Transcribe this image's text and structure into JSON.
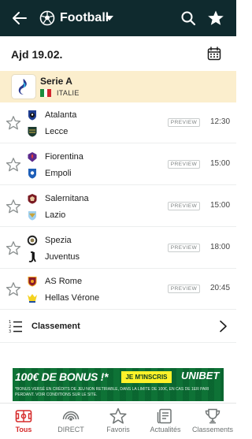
{
  "header": {
    "title": "Football",
    "icons": {
      "back": "back-arrow-icon",
      "sport": "football-icon",
      "dropdown": "caret-down-icon",
      "search": "search-icon",
      "favorite": "star-icon"
    },
    "bg_color": "#0f2a2e"
  },
  "date": {
    "label": "Ajd 19.02.",
    "icon": "calendar-icon"
  },
  "league": {
    "name": "Serie A",
    "country": "ITALIE",
    "logo_text": "SERIE A",
    "bg_color": "#fbeecd"
  },
  "matches": [
    {
      "home": "Atalanta",
      "away": "Lecce",
      "badge": "PREVIEW",
      "time": "12:30"
    },
    {
      "home": "Fiorentina",
      "away": "Empoli",
      "badge": "PREVIEW",
      "time": "15:00"
    },
    {
      "home": "Salernitana",
      "away": "Lazio",
      "badge": "PREVIEW",
      "time": "15:00"
    },
    {
      "home": "Spezia",
      "away": "Juventus",
      "badge": "PREVIEW",
      "time": "18:00"
    },
    {
      "home": "AS Rome",
      "away": "Hellas Vérone",
      "badge": "PREVIEW",
      "time": "20:45"
    }
  ],
  "standings": {
    "label": "Classement"
  },
  "ad": {
    "headline": "100€ DE BONUS !*",
    "cta": "JE M'INSCRIS",
    "brand": "UNIBET",
    "fine_print": "*BONUS VERSÉ EN CRÉDITS DE JEU NON RETIRABLE, DANS LA LIMITE DE 100€, EN CAS DE 1ER PARI PERDANT. VOIR CONDITIONS SUR LE SITE."
  },
  "nav": [
    {
      "label": "Tous",
      "icon": "pitch-icon",
      "active": true
    },
    {
      "label": "DIRECT",
      "icon": "live-broadcast-icon",
      "active": false
    },
    {
      "label": "Favoris",
      "icon": "star-outline-icon",
      "active": false
    },
    {
      "label": "Actualités",
      "icon": "news-icon",
      "active": false
    },
    {
      "label": "Classements",
      "icon": "trophy-icon",
      "active": false
    }
  ],
  "accent_color": "#d62b2b"
}
